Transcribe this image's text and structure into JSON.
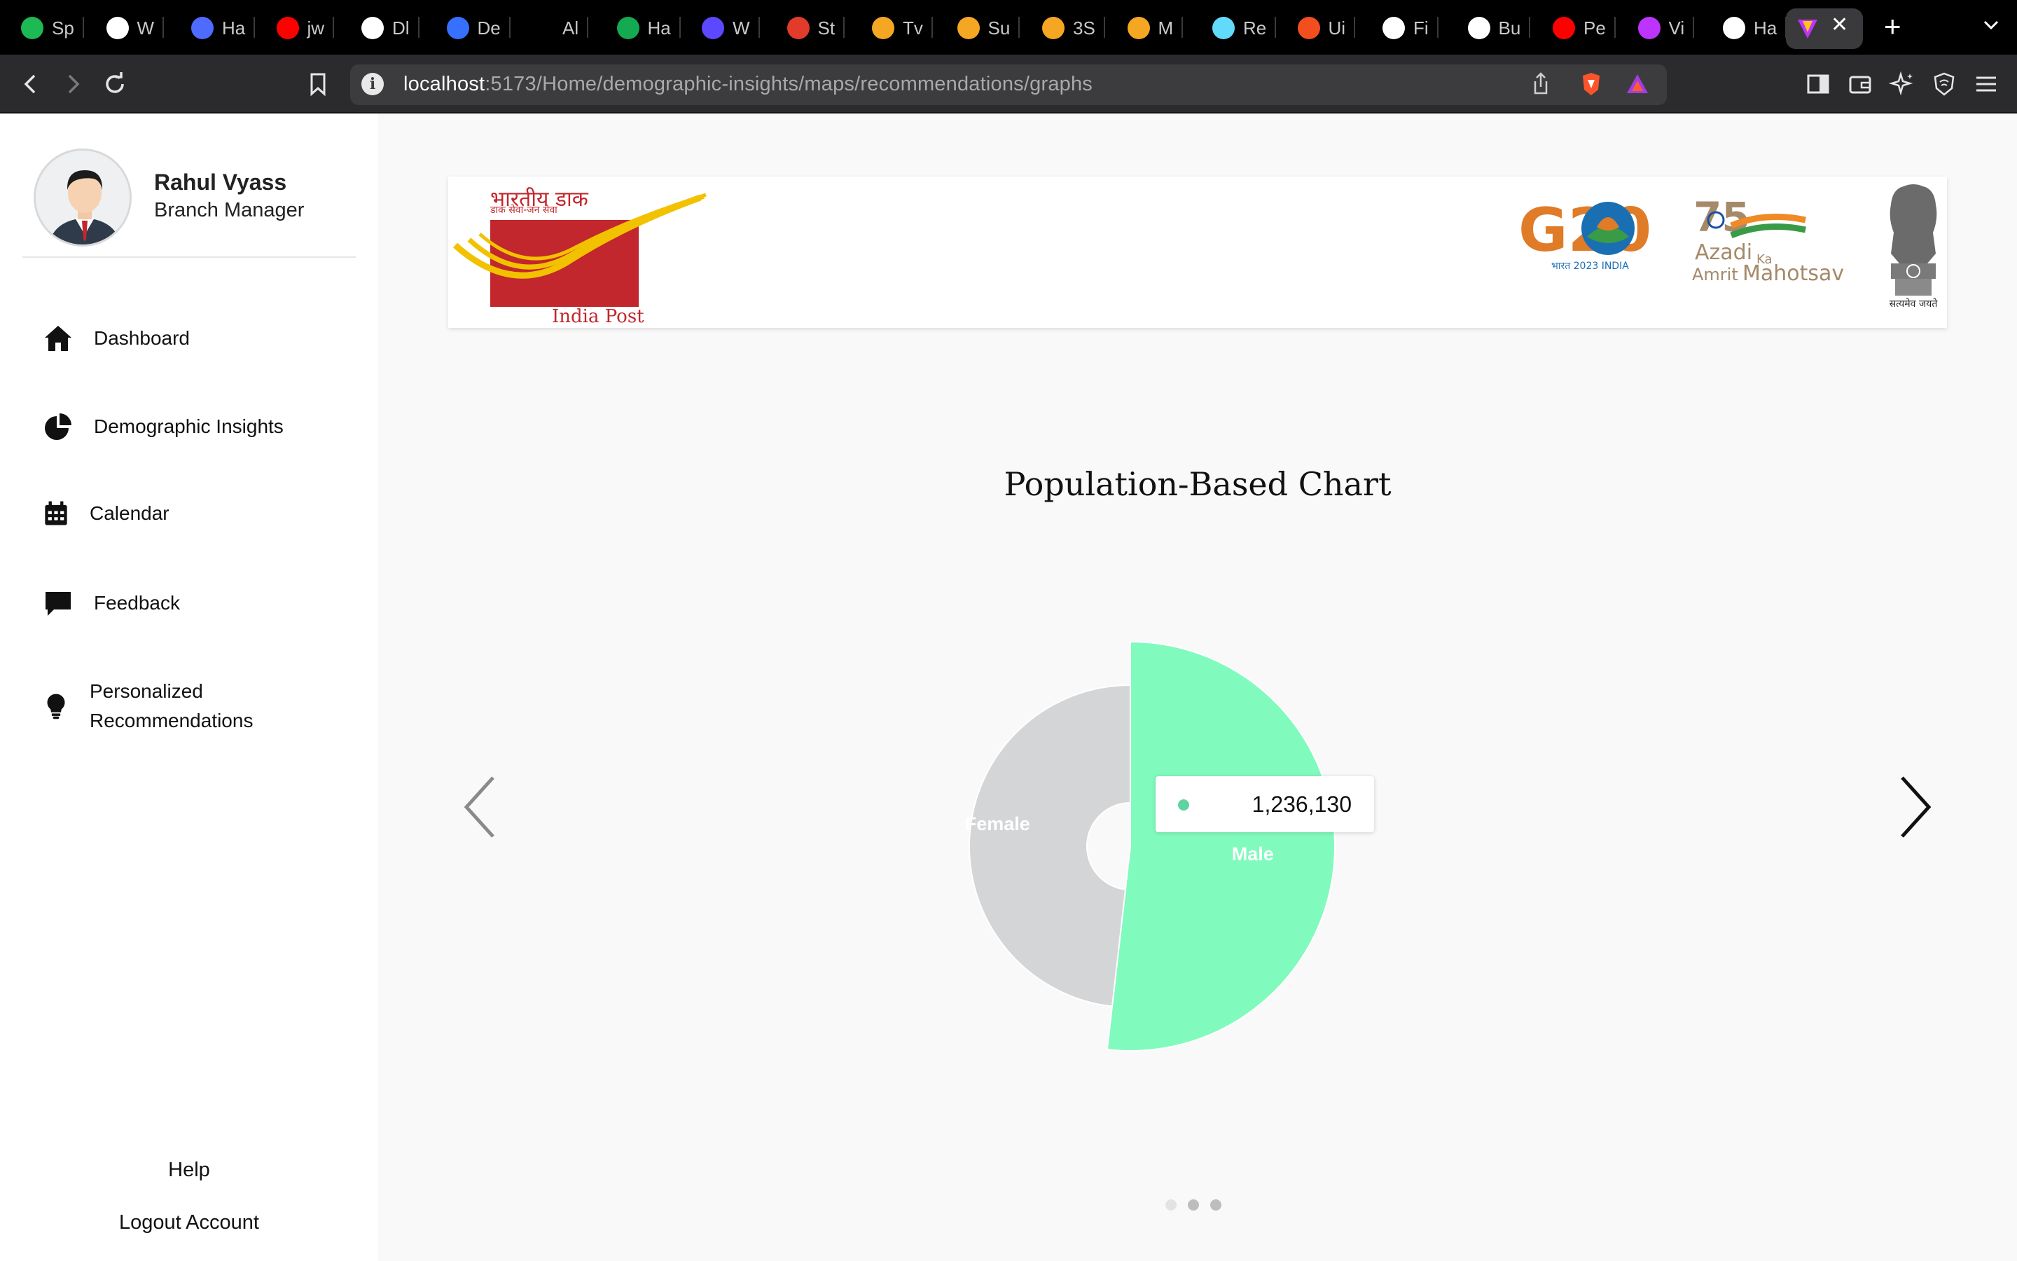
{
  "browser": {
    "tabs": [
      {
        "label": "Sp",
        "icon": "spotify-icon",
        "color": "#1db954"
      },
      {
        "label": "W",
        "icon": "openai-icon",
        "color": "#ffffff"
      },
      {
        "label": "Ha",
        "icon": "app-icon",
        "color": "#4d6bff"
      },
      {
        "label": "jw",
        "icon": "youtube-icon",
        "color": "#ff0000"
      },
      {
        "label": "Dl",
        "icon": "github-icon",
        "color": "#ffffff"
      },
      {
        "label": "De",
        "icon": "devfolio-icon",
        "color": "#3770ff"
      },
      {
        "label": "Al",
        "icon": "blank-icon",
        "color": "#000000"
      },
      {
        "label": "Ha",
        "icon": "mongodb-icon",
        "color": "#13aa52"
      },
      {
        "label": "W",
        "icon": "webstorm-icon",
        "color": "#5c48ff"
      },
      {
        "label": "St",
        "icon": "tuf-icon",
        "color": "#e23b2b"
      },
      {
        "label": "Tv",
        "icon": "codestudio-icon",
        "color": "#f5a623"
      },
      {
        "label": "Su",
        "icon": "codestudio-icon",
        "color": "#f5a623"
      },
      {
        "label": "3S",
        "icon": "codestudio-icon",
        "color": "#f5a623"
      },
      {
        "label": "M",
        "icon": "codestudio-icon",
        "color": "#f5a623"
      },
      {
        "label": "Re",
        "icon": "react-icon",
        "color": "#61dafb"
      },
      {
        "label": "Ui",
        "icon": "figma-icon",
        "color": "#f24e1e"
      },
      {
        "label": "Fi",
        "icon": "bolt-icon",
        "color": "#ffffff"
      },
      {
        "label": "Bu",
        "icon": "bolt-icon",
        "color": "#ffffff"
      },
      {
        "label": "Pe",
        "icon": "youtube-icon",
        "color": "#ff0000"
      },
      {
        "label": "Vi",
        "icon": "vite-icon",
        "color": "#bd34fe"
      },
      {
        "label": "Ha",
        "icon": "github-icon",
        "color": "#ffffff"
      }
    ],
    "active_tab_icon": "vite-icon",
    "url_host": "localhost",
    "url_path": ":5173/Home/demographic-insights/maps/recommendations/graphs"
  },
  "user": {
    "name": "Rahul Vyass",
    "role": "Branch Manager"
  },
  "menu": [
    {
      "label": "Dashboard",
      "icon": "home-icon"
    },
    {
      "label": "Demographic Insights",
      "icon": "pie-chart-icon"
    },
    {
      "label": "Calendar",
      "icon": "calendar-icon"
    },
    {
      "label": "Feedback",
      "icon": "chat-icon"
    },
    {
      "label_line1": "Personalized",
      "label_line2": "Recommendations",
      "icon": "lightbulb-icon"
    }
  ],
  "footer_links": {
    "help": "Help",
    "logout": "Logout Account"
  },
  "banner": {
    "india_post_hindi": "भारतीय डाक",
    "india_post_tagline": "डाक सेवा-जन सेवा",
    "india_post_label": "India Post",
    "g20_label": "G20",
    "g20_sub": "भारत 2023 INDIA",
    "azadi_number": "75",
    "azadi_line1": "Azadi",
    "azadi_ka": "Ka",
    "azadi_line2_a": "Amrit",
    "azadi_line2_b": "Mahotsav",
    "emblem_motto": "सत्यमेव जयते",
    "colors": {
      "post_red": "#c1272d",
      "post_yellow": "#f2c200",
      "g20_orange": "#e07b27",
      "g20_green": "#3a9b47",
      "g20_blue": "#1a6fb3"
    }
  },
  "chart_data": {
    "type": "pie",
    "title": "Population-Based Chart",
    "slices": [
      {
        "label": "Female",
        "value": 1150000,
        "color": "#d4d5d7"
      },
      {
        "label": "Male",
        "value": 1236130,
        "color": "#80fbbd"
      }
    ],
    "active_slice": "Male",
    "tooltip": {
      "value": "1,236,130",
      "dot_color": "#5fd3a0"
    },
    "carousel_pages": 3,
    "active_page": 1
  }
}
